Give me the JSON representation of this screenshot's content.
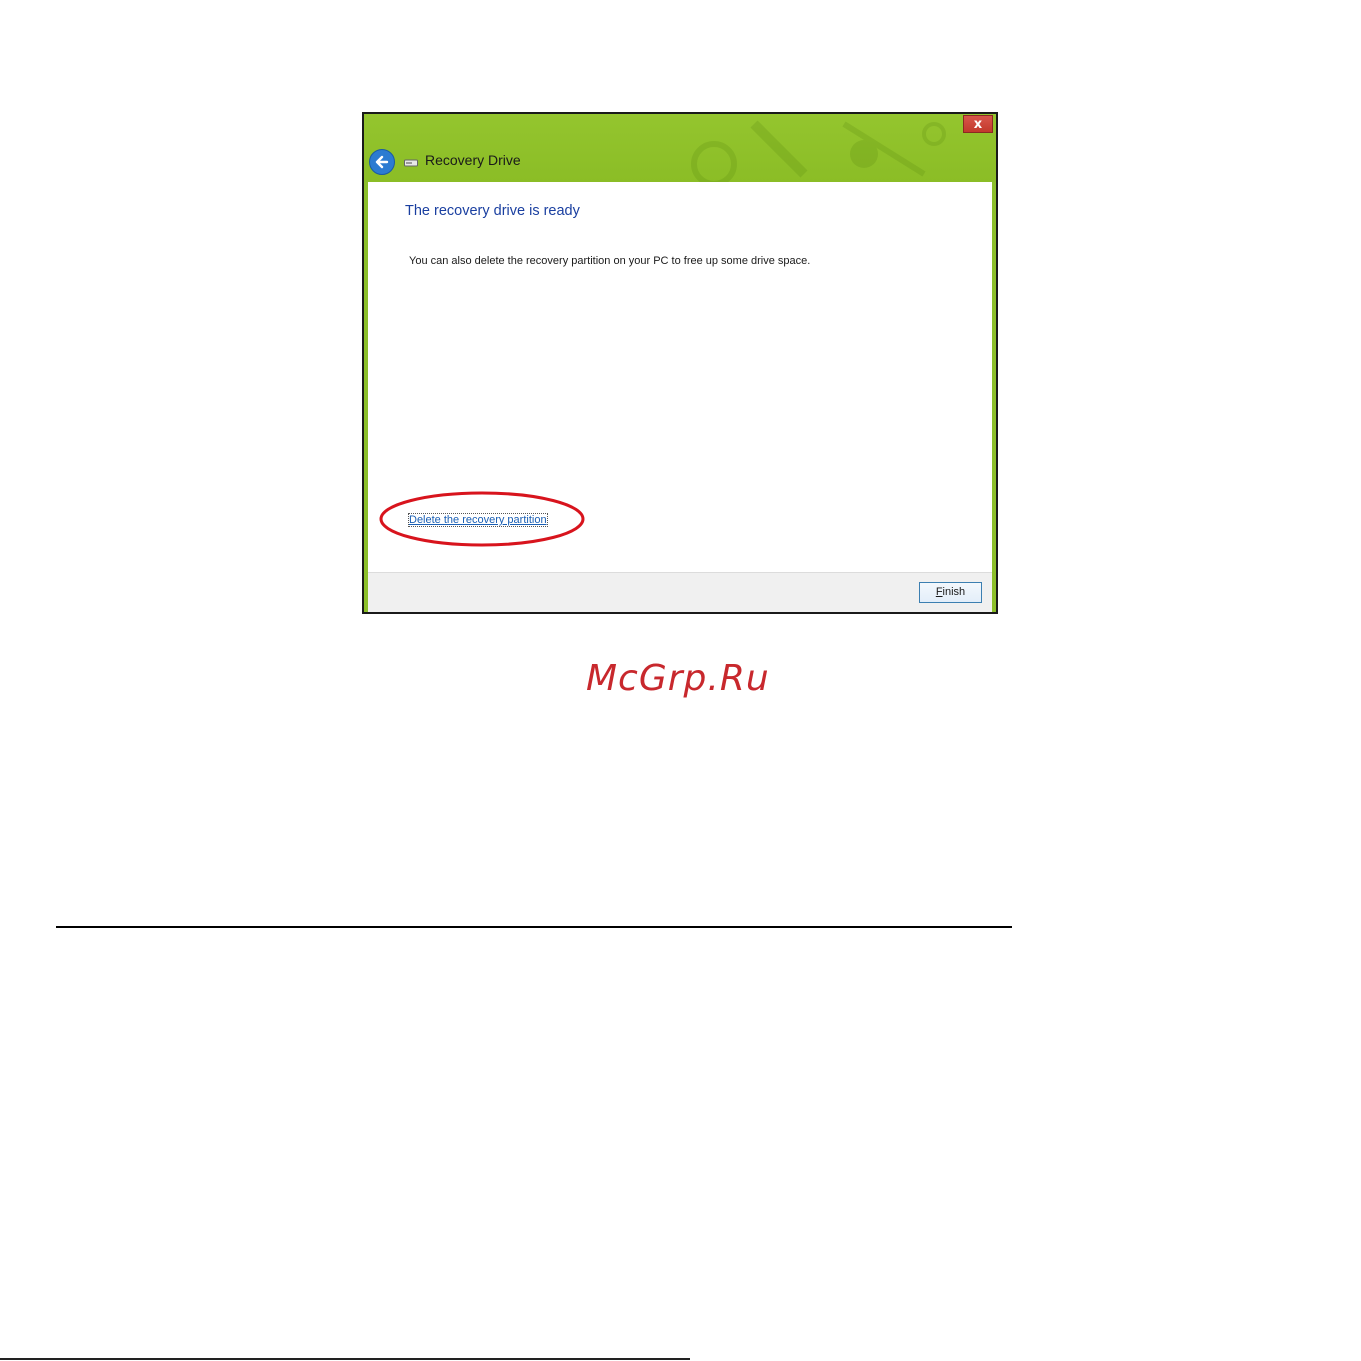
{
  "window": {
    "title": "Recovery Drive",
    "close_label": "x",
    "accent_color": "#8cbf2a"
  },
  "content": {
    "heading": "The recovery drive is ready",
    "description": "You can also delete the recovery partition on your PC to free up some drive space.",
    "link_label": "Delete the recovery partition"
  },
  "footer": {
    "finish_label_underlined": "F",
    "finish_label_rest": "inish"
  },
  "watermark": {
    "text": "McGrp.Ru",
    "color": "#c8282d"
  },
  "icons": {
    "back": "arrow-left-icon",
    "drive": "drive-icon",
    "close": "close-icon"
  }
}
